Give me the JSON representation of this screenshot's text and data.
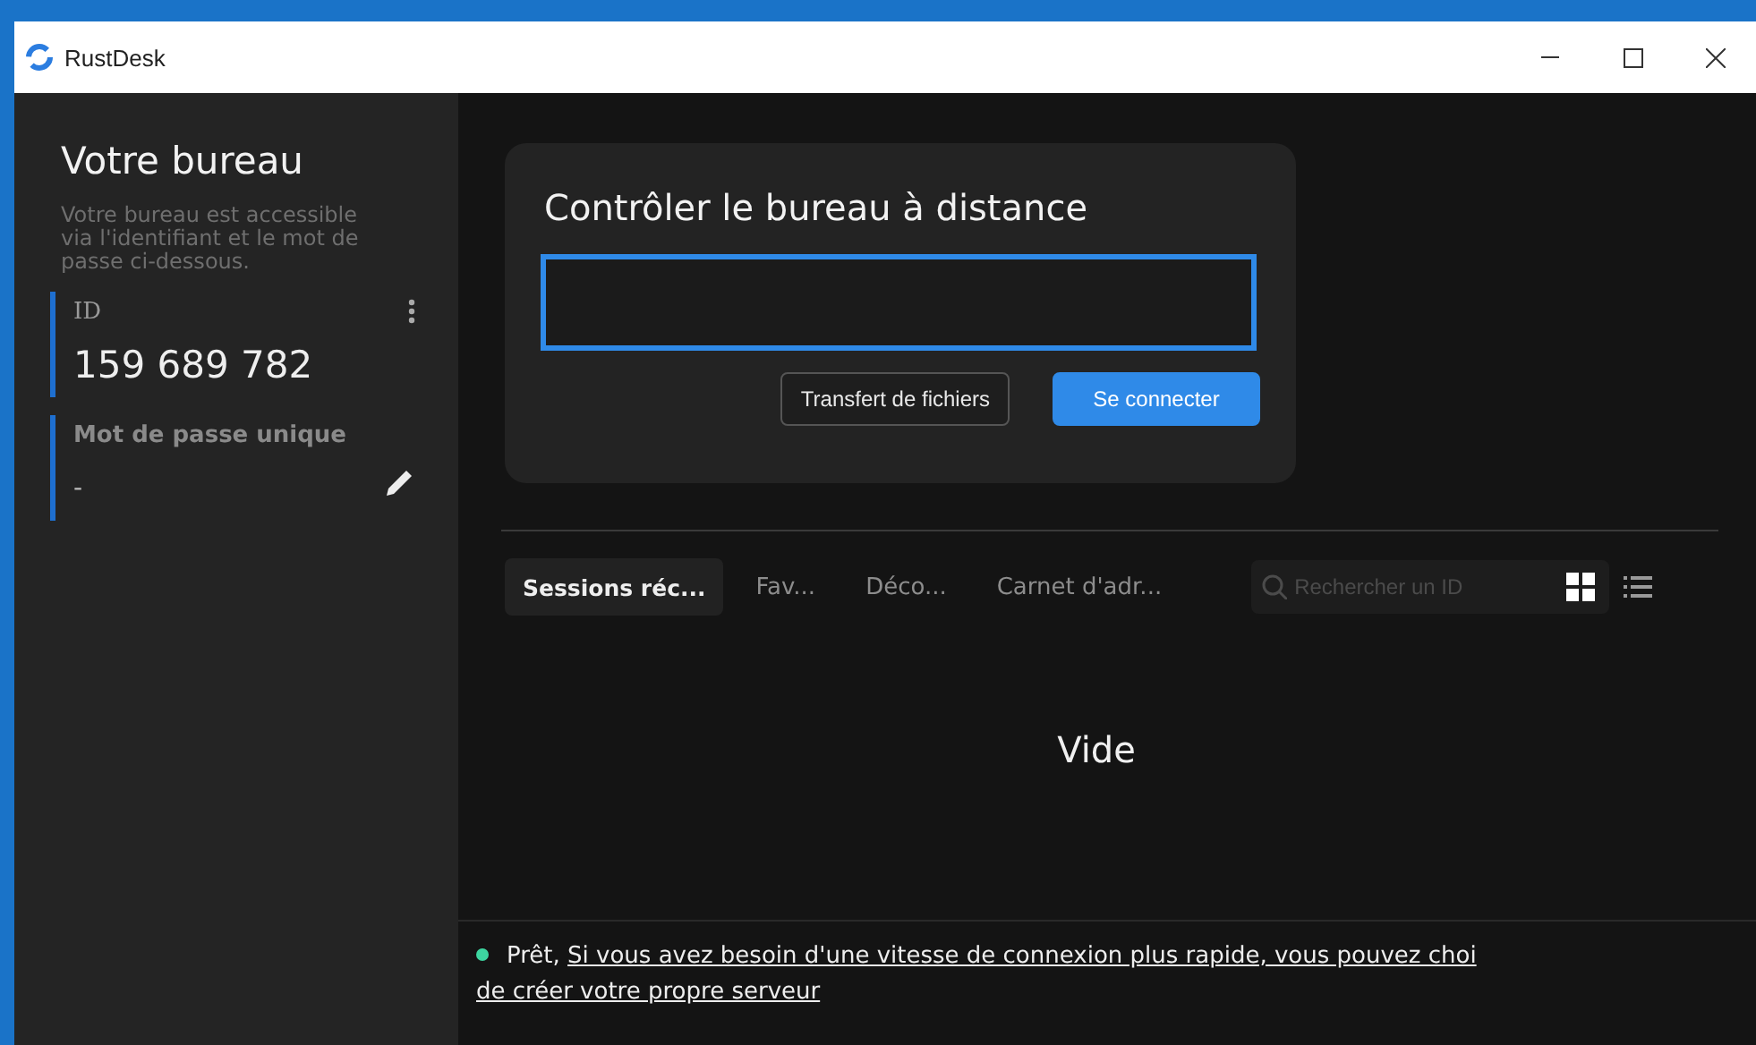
{
  "window": {
    "title": "RustDesk"
  },
  "sidebar": {
    "title": "Votre bureau",
    "description": "Votre bureau est accessible via l'identifiant et le mot de passe ci-dessous.",
    "id_label": "ID",
    "id_value": "159 689 782",
    "password_label": "Mot de passe unique",
    "password_value": "-"
  },
  "connect": {
    "title": "Contrôler le bureau à distance",
    "field_focused": true,
    "buttons": [
      {
        "label": "Transfert de fichiers",
        "kind": "secondary"
      },
      {
        "label": "Se connecter",
        "kind": "primary"
      }
    ]
  },
  "tabs": [
    {
      "label": "Sessions réc...",
      "selected": true
    },
    {
      "label": "Fav...",
      "selected": false
    },
    {
      "label": "Déco...",
      "selected": false
    },
    {
      "label": "Carnet d'adr...",
      "selected": false
    }
  ],
  "search": {
    "placeholder": "Rechercher un ID"
  },
  "view_modes": [
    {
      "kind": "grid",
      "selected": true
    },
    {
      "kind": "list",
      "selected": false
    }
  ],
  "empty_text": "Vide",
  "status": {
    "color": "#3dd6a0",
    "text": "Prêt,",
    "link": "Si vous avez besoin d'une vitesse de connexion plus rapide, vous pouvez choi",
    "link_line2": "de créer votre propre serveur"
  }
}
